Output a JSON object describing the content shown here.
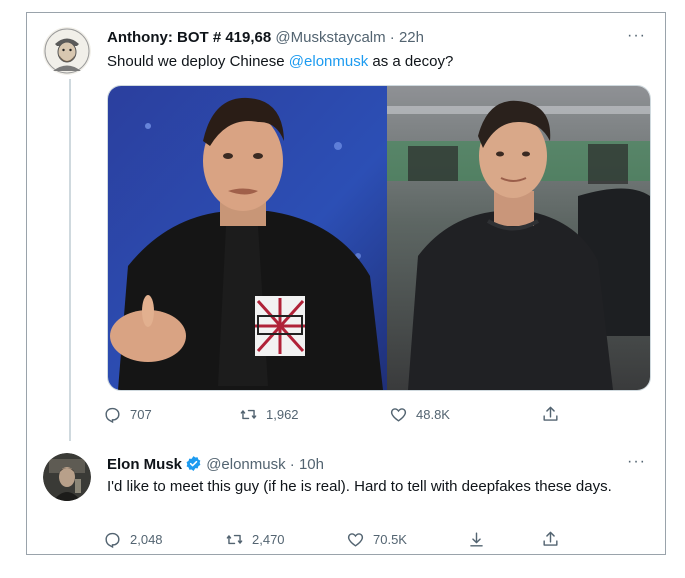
{
  "tweet1": {
    "display_name": "Anthony: BOT # 419,68",
    "handle": "@Muskstaycalm",
    "separator": "·",
    "time": "22h",
    "text_before": "Should we deploy Chinese ",
    "mention": "@elonmusk",
    "text_after": " as a decoy?",
    "more": "···",
    "stats": {
      "replies": "707",
      "retweets": "1,962",
      "likes": "48.8K"
    }
  },
  "tweet2": {
    "display_name": "Elon Musk",
    "handle": "@elonmusk",
    "separator": "·",
    "time": "10h",
    "text": "I'd like to meet this guy (if he is real). Hard to tell with deepfakes these days.",
    "more": "···",
    "stats": {
      "replies": "2,048",
      "retweets": "2,470",
      "likes": "70.5K"
    }
  },
  "colors": {
    "accent": "#1d9bf0",
    "secondary_text": "#536471",
    "primary_text": "#0f1419",
    "border": "#cfd9de"
  },
  "icons": [
    "reply-icon",
    "retweet-icon",
    "like-icon",
    "share-icon",
    "download-icon",
    "verified-badge-icon",
    "more-icon"
  ]
}
